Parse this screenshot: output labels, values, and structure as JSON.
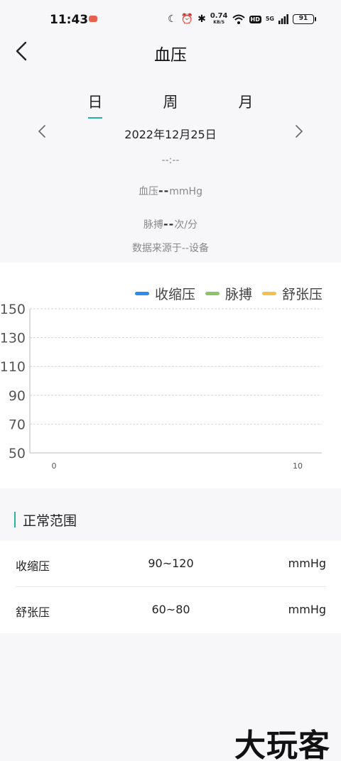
{
  "status_bar": {
    "time": "11:43",
    "net_speed_value": "0.74",
    "net_speed_unit": "KB/S",
    "hd": "HD",
    "signal": "5G",
    "battery": "91"
  },
  "header": {
    "title": "血压"
  },
  "tabs": [
    {
      "label": "日",
      "active": true
    },
    {
      "label": "周",
      "active": false
    },
    {
      "label": "月",
      "active": false
    }
  ],
  "date": "2022年12月25日",
  "summary": {
    "time": "--:--",
    "bp_label": "血压",
    "bp_value": "--",
    "bp_unit": "mmHg",
    "pulse_label": "脉搏",
    "pulse_value": "--",
    "pulse_unit": "次/分",
    "source": "数据来源于--设备"
  },
  "chart_data": {
    "type": "line",
    "series": [
      {
        "name": "收缩压",
        "color": "#2a8cf0",
        "values": []
      },
      {
        "name": "脉搏",
        "color": "#8cc46a",
        "values": []
      },
      {
        "name": "舒张压",
        "color": "#f2c24b",
        "values": []
      }
    ],
    "x_ticks": [
      "0",
      "10"
    ],
    "y_ticks": [
      "150",
      "130",
      "110",
      "90",
      "70",
      "50"
    ],
    "xlim": [
      0,
      10
    ],
    "ylim": [
      50,
      150
    ],
    "grid": true,
    "legend": "top-right"
  },
  "normal_range": {
    "title": "正常范围",
    "rows": [
      {
        "name": "收缩压",
        "range": "90~120",
        "unit": "mmHg"
      },
      {
        "name": "舒张压",
        "range": "60~80",
        "unit": "mmHg"
      }
    ]
  },
  "watermark": "大玩客"
}
